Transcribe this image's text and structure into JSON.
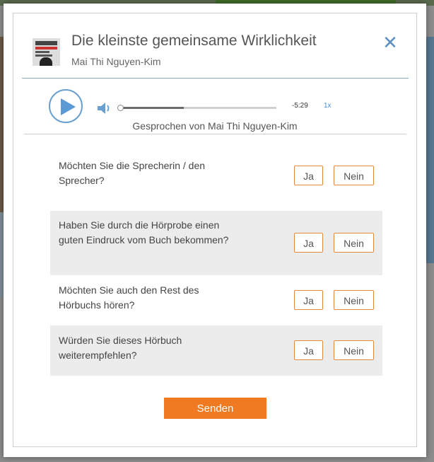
{
  "book": {
    "title": "Die kleinste gemeinsame Wirklichkeit",
    "author": "Mai Thi Nguyen-Kim"
  },
  "player": {
    "time_remaining": "-5:29",
    "speed": "1x",
    "narrator": "Gesprochen von Mai Thi Nguyen-Kim",
    "progress": 0.41
  },
  "questions": [
    {
      "text": "Möchten Sie die Sprecherin / den Sprecher?",
      "yes": "Ja",
      "no": "Nein"
    },
    {
      "text": "Haben Sie durch die Hörprobe einen guten Eindruck vom Buch bekommen?",
      "yes": "Ja",
      "no": "Nein"
    },
    {
      "text": "Möchten Sie auch den Rest des Hörbuchs hören?",
      "yes": "Ja",
      "no": "Nein"
    },
    {
      "text": "Würden Sie dieses Hörbuch weiterempfehlen?",
      "yes": "Ja",
      "no": "Nein"
    }
  ],
  "submit_label": "Senden",
  "colors": {
    "accent": "#ef7a22",
    "blue": "#5b8fc4"
  },
  "icons": {
    "play": "play-icon",
    "volume": "volume-icon",
    "close": "close-icon"
  }
}
